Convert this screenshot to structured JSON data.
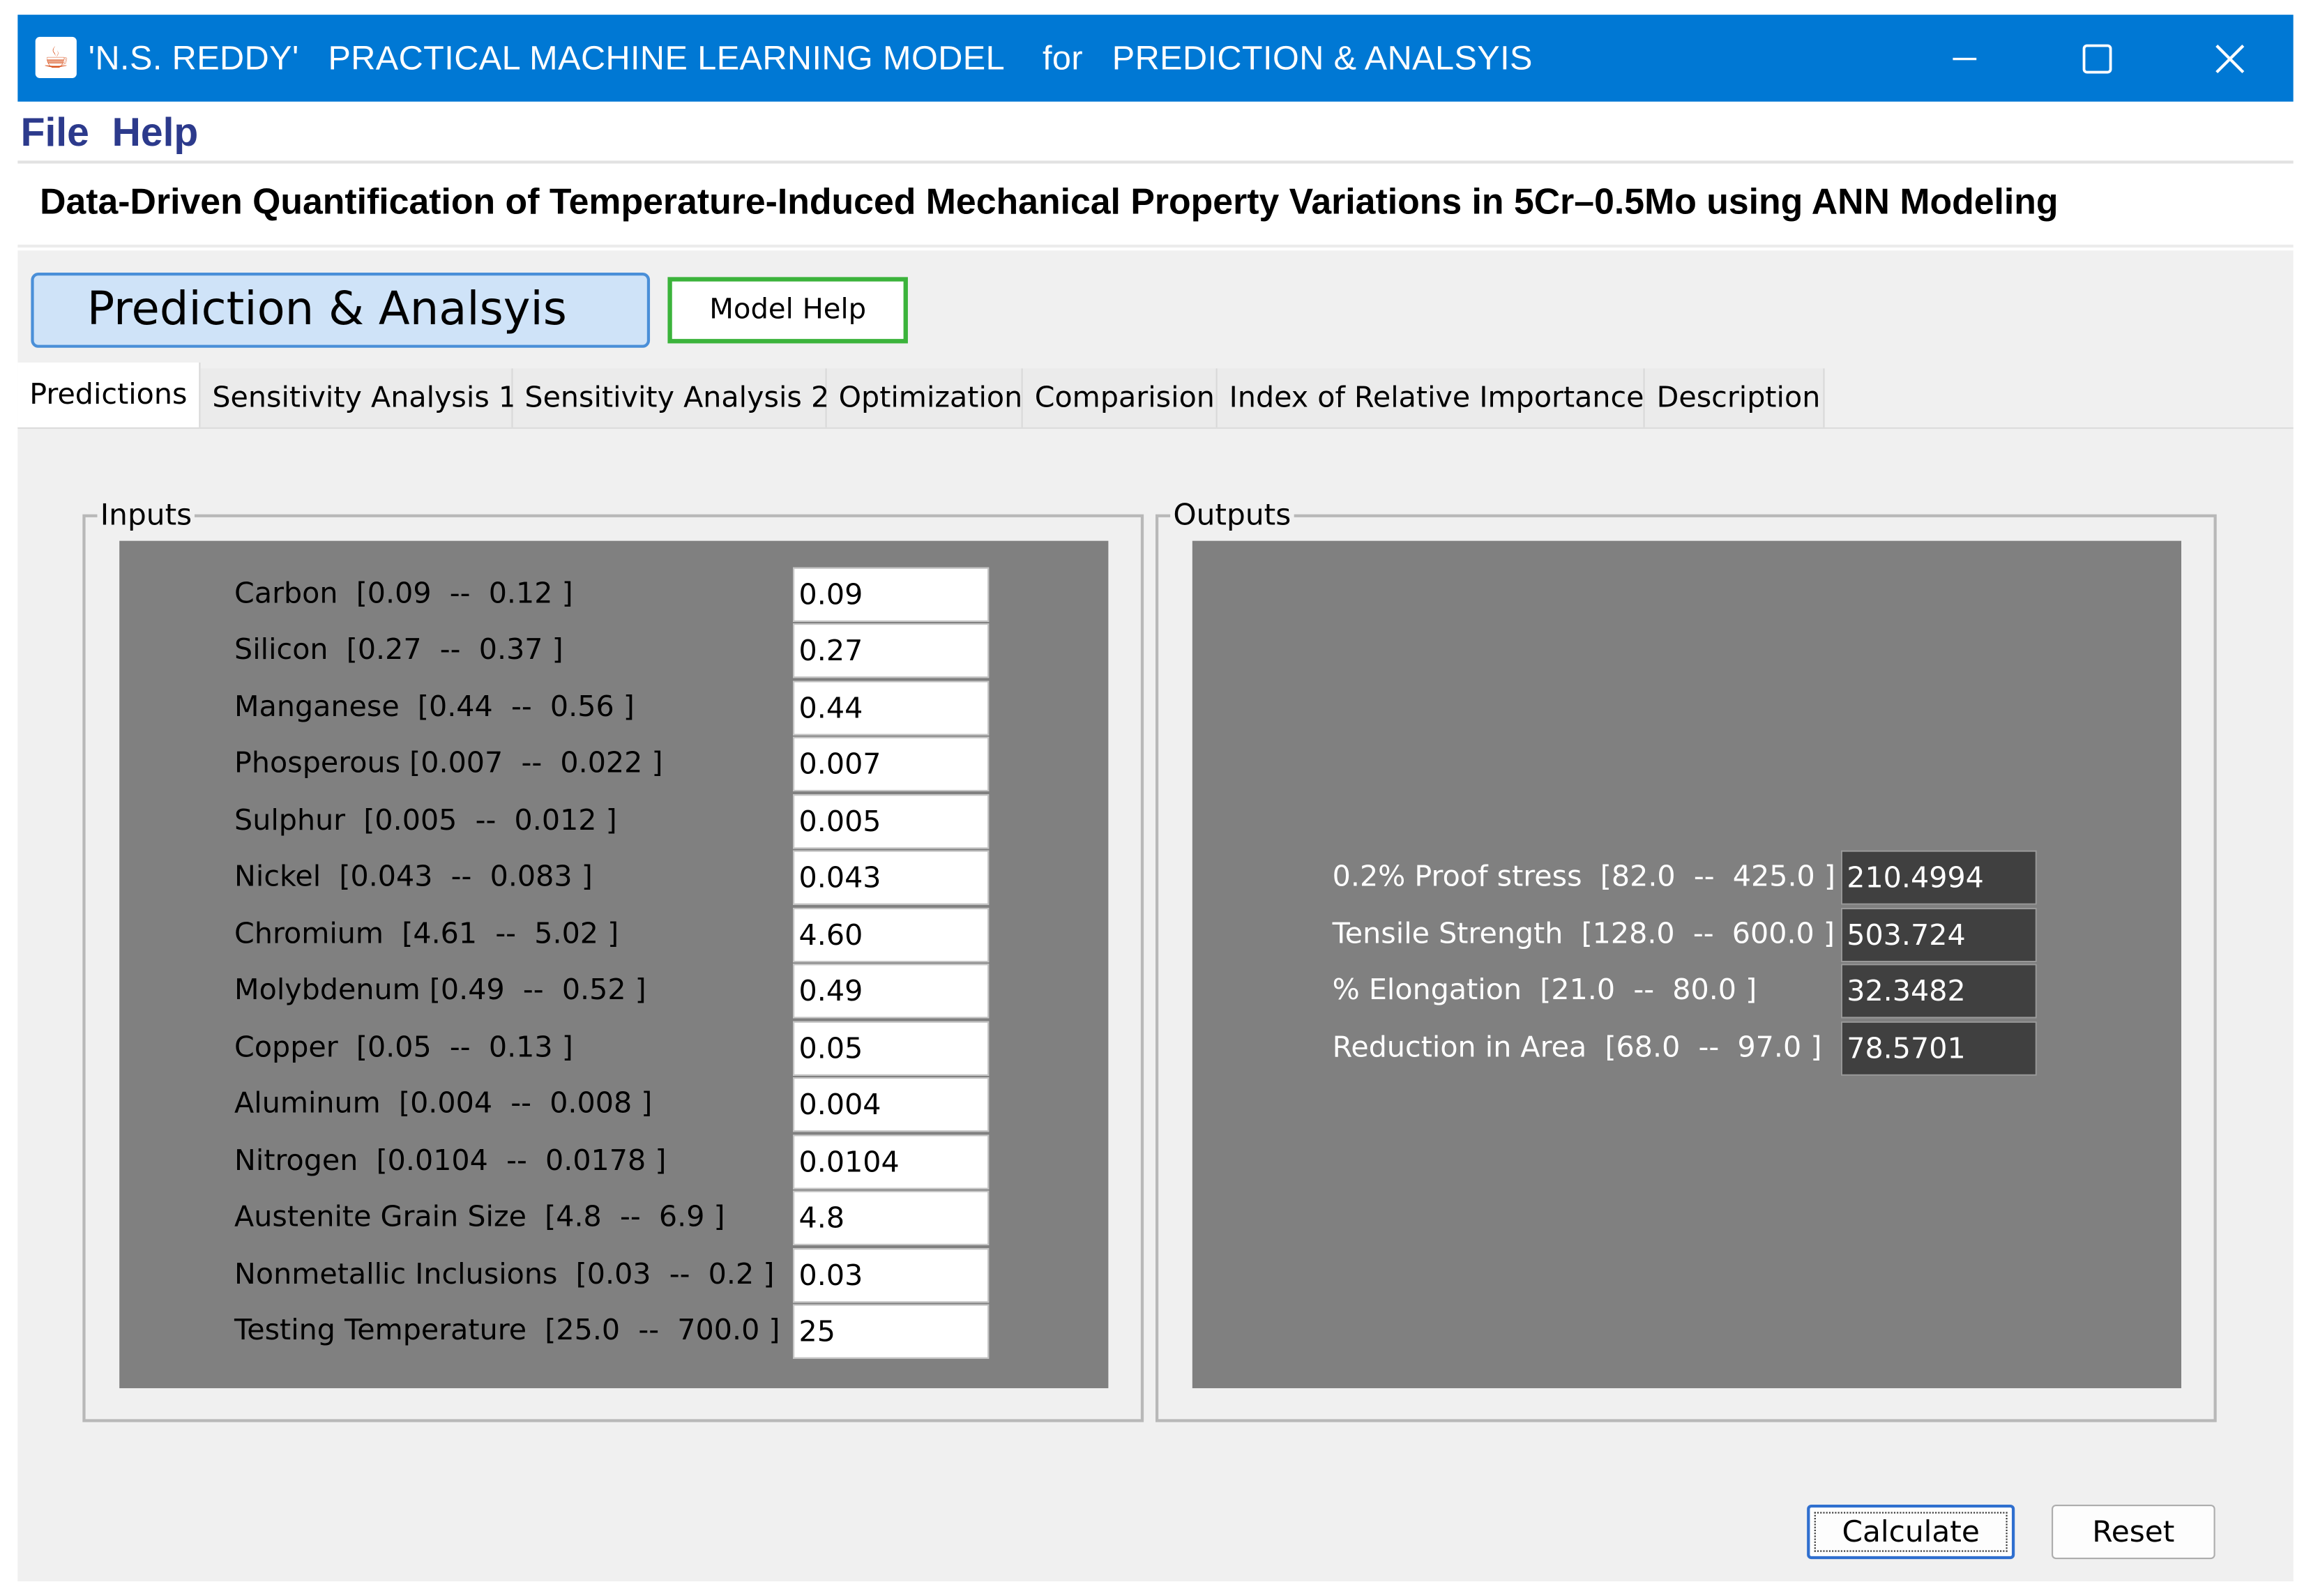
{
  "window": {
    "title": "'N.S. REDDY'   PRACTICAL MACHINE LEARNING MODEL    for   PREDICTION & ANALSYIS",
    "icon": "java-coffee-icon",
    "controls": [
      "minimize-icon",
      "maximize-icon",
      "close-icon"
    ]
  },
  "menu": {
    "file": "File",
    "help": "Help"
  },
  "heading": "Data-Driven Quantification of Temperature-Induced Mechanical Property Variations in 5Cr–0.5Mo using ANN Modeling",
  "banner": {
    "title": "Prediction & Analsyis",
    "model_help": "Model Help"
  },
  "tabs": [
    {
      "label": "Predictions",
      "active": true
    },
    {
      "label": "Sensitivity Analysis 1"
    },
    {
      "label": "Sensitivity Analysis 2"
    },
    {
      "label": "Optimization"
    },
    {
      "label": "Comparision"
    },
    {
      "label": "Index of Relative Importance"
    },
    {
      "label": "Description"
    }
  ],
  "inputs": {
    "title": "Inputs",
    "fields": [
      {
        "label": "Carbon  [0.09  --  0.12 ]",
        "value": "0.09"
      },
      {
        "label": "Silicon  [0.27  --  0.37 ]",
        "value": "0.27"
      },
      {
        "label": "Manganese  [0.44  --  0.56 ]",
        "value": "0.44"
      },
      {
        "label": "Phosperous [0.007  --  0.022 ]",
        "value": "0.007"
      },
      {
        "label": "Sulphur  [0.005  --  0.012 ]",
        "value": "0.005"
      },
      {
        "label": "Nickel  [0.043  --  0.083 ]",
        "value": "0.043"
      },
      {
        "label": "Chromium  [4.61  --  5.02 ]",
        "value": "4.60"
      },
      {
        "label": "Molybdenum [0.49  --  0.52 ]",
        "value": "0.49"
      },
      {
        "label": "Copper  [0.05  --  0.13 ]",
        "value": "0.05"
      },
      {
        "label": "Aluminum  [0.004  --  0.008 ]",
        "value": "0.004"
      },
      {
        "label": "Nitrogen  [0.0104  --  0.0178 ]",
        "value": "0.0104"
      },
      {
        "label": "Austenite Grain Size  [4.8  --  6.9 ]",
        "value": "4.8"
      },
      {
        "label": "Nonmetallic Inclusions  [0.03  --  0.2 ]",
        "value": "0.03"
      },
      {
        "label": "Testing Temperature  [25.0  --  700.0 ]",
        "value": "25"
      }
    ]
  },
  "outputs": {
    "title": "Outputs",
    "fields": [
      {
        "label": "0.2% Proof stress  [82.0  --  425.0 ]",
        "value": "210.4994"
      },
      {
        "label": "Tensile Strength  [128.0  --  600.0 ]",
        "value": "503.724"
      },
      {
        "label": "% Elongation  [21.0  --  80.0 ]",
        "value": "32.3482"
      },
      {
        "label": "Reduction in Area  [68.0  --  97.0 ]",
        "value": "78.5701"
      }
    ]
  },
  "actions": {
    "calculate": "Calculate",
    "reset": "Reset"
  },
  "colors": {
    "titlebar": "#0078d4",
    "panel_grey": "#808080",
    "output_field": "#404040",
    "banner_fill": "#cfe3f8",
    "model_help_border": "#3bb33b"
  }
}
